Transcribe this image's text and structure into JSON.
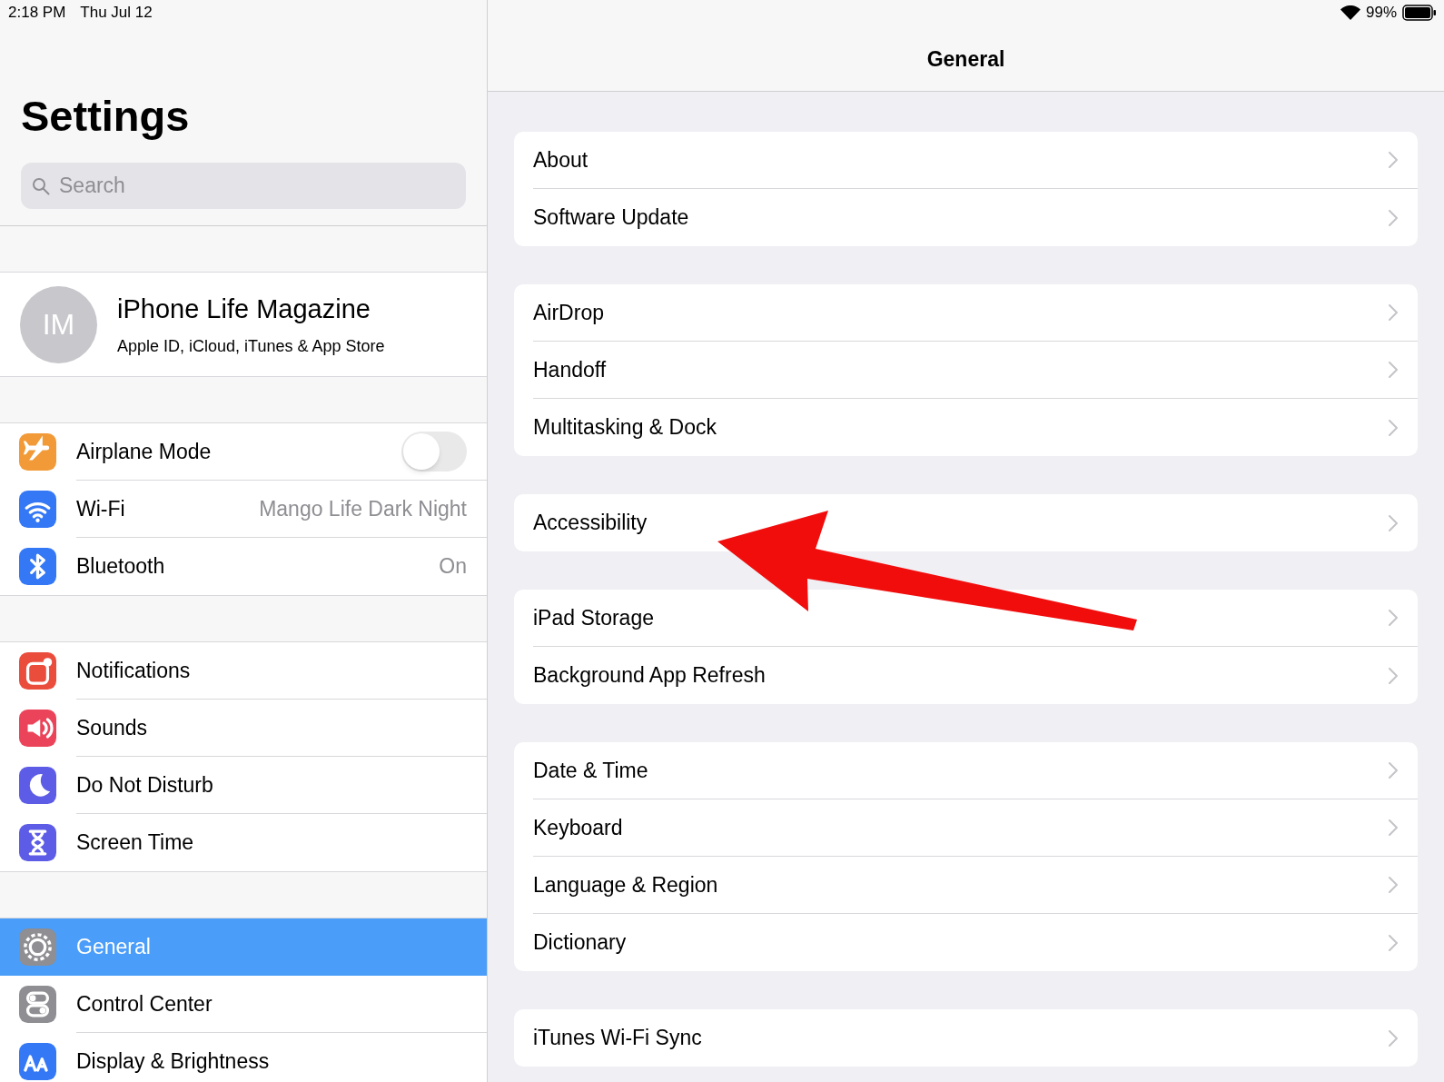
{
  "status_bar": {
    "time": "2:18 PM",
    "date": "Thu Jul 12",
    "battery": "99%"
  },
  "sidebar": {
    "title": "Settings",
    "search": {
      "placeholder": "Search"
    },
    "profile": {
      "initials": "IM",
      "name": "iPhone Life Magazine",
      "subtitle": "Apple ID, iCloud, iTunes & App Store"
    },
    "groups": [
      [
        {
          "label": "Airplane Mode",
          "kind": "toggle",
          "on": false,
          "color": "#f19a37",
          "selected": false
        },
        {
          "label": "Wi-Fi",
          "kind": "value",
          "value": "Mango Life Dark Night",
          "color": "#3478f6",
          "selected": false
        },
        {
          "label": "Bluetooth",
          "kind": "value",
          "value": "On",
          "color": "#3478f6",
          "selected": false
        }
      ],
      [
        {
          "label": "Notifications",
          "kind": "plain",
          "color": "#eb4d3d",
          "selected": false
        },
        {
          "label": "Sounds",
          "kind": "plain",
          "color": "#eb445a",
          "selected": false
        },
        {
          "label": "Do Not Disturb",
          "kind": "plain",
          "color": "#5d5ce6",
          "selected": false
        },
        {
          "label": "Screen Time",
          "kind": "plain",
          "color": "#5d5ce6",
          "selected": false
        }
      ],
      [
        {
          "label": "General",
          "kind": "plain",
          "color": "#8e8e93",
          "selected": true
        },
        {
          "label": "Control Center",
          "kind": "plain",
          "color": "#8e8e93",
          "selected": false
        },
        {
          "label": "Display & Brightness",
          "kind": "plain",
          "color": "#3478f6",
          "selected": false
        }
      ]
    ]
  },
  "detail": {
    "title": "General",
    "groups": [
      [
        "About",
        "Software Update"
      ],
      [
        "AirDrop",
        "Handoff",
        "Multitasking & Dock"
      ],
      [
        "Accessibility"
      ],
      [
        "iPad Storage",
        "Background App Refresh"
      ],
      [
        "Date & Time",
        "Keyboard",
        "Language & Region",
        "Dictionary"
      ],
      [
        "iTunes Wi-Fi Sync"
      ]
    ]
  }
}
